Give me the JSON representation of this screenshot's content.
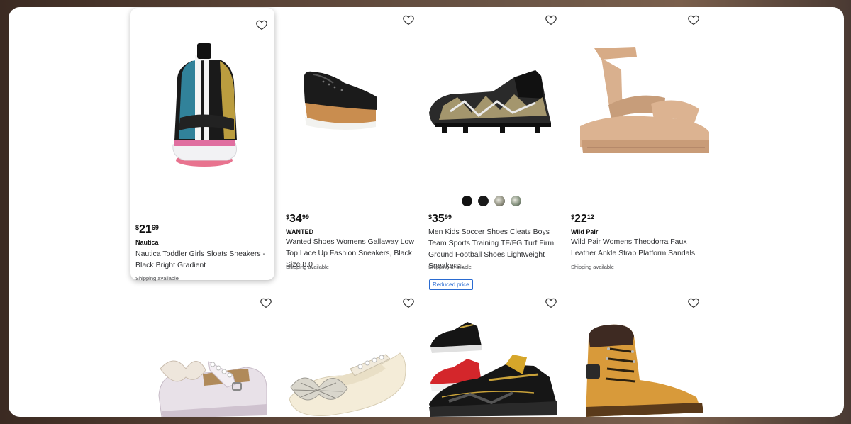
{
  "products_row1": [
    {
      "price_currency": "$",
      "price_dollars": "21",
      "price_cents": "69",
      "brand": "Nautica",
      "title": "Nautica Toddler Girls Sloats Sneakers - Black Bright Gradient",
      "shipping": "Shipping available",
      "image_icon": "sneaker-image"
    },
    {
      "price_currency": "$",
      "price_dollars": "34",
      "price_cents": "99",
      "brand": "WANTED",
      "title": "Wanted Shoes Womens Gallaway Low Top Lace Up Fashion Sneakers, Black, Size 8.0",
      "shipping": "Shipping available",
      "image_icon": "oxford-platform-image"
    },
    {
      "price_currency": "$",
      "price_dollars": "35",
      "price_cents": "99",
      "brand": "",
      "title": "Men Kids Soccer Shoes Cleats Boys Team Sports Training TF/FG Turf Firm Ground Football Shoes Lightweight Sneakers...",
      "shipping": "Shipping available",
      "image_icon": "soccer-cleat-image",
      "swatch_colors": [
        "#111111",
        "#1a1a1a",
        "#8a8a7a",
        "#7c8a76"
      ]
    },
    {
      "price_currency": "$",
      "price_dollars": "22",
      "price_cents": "12",
      "brand": "Wild Pair",
      "title": "Wild Pair Womens Theodorra Faux Leather Ankle Strap Platform Sandals",
      "shipping": "Shipping available",
      "image_icon": "platform-sandal-image"
    }
  ],
  "badge": {
    "label": "Reduced price"
  },
  "products_row2": [
    {
      "image_icon": "girls-mary-jane-image"
    },
    {
      "image_icon": "pearl-flat-image"
    },
    {
      "image_icon": "kids-sneakers-image"
    },
    {
      "image_icon": "work-boot-image"
    }
  ],
  "colors": {
    "page_bg": "#ffffff",
    "badge_blue": "#2a6bd1",
    "text_dark": "#111111"
  }
}
